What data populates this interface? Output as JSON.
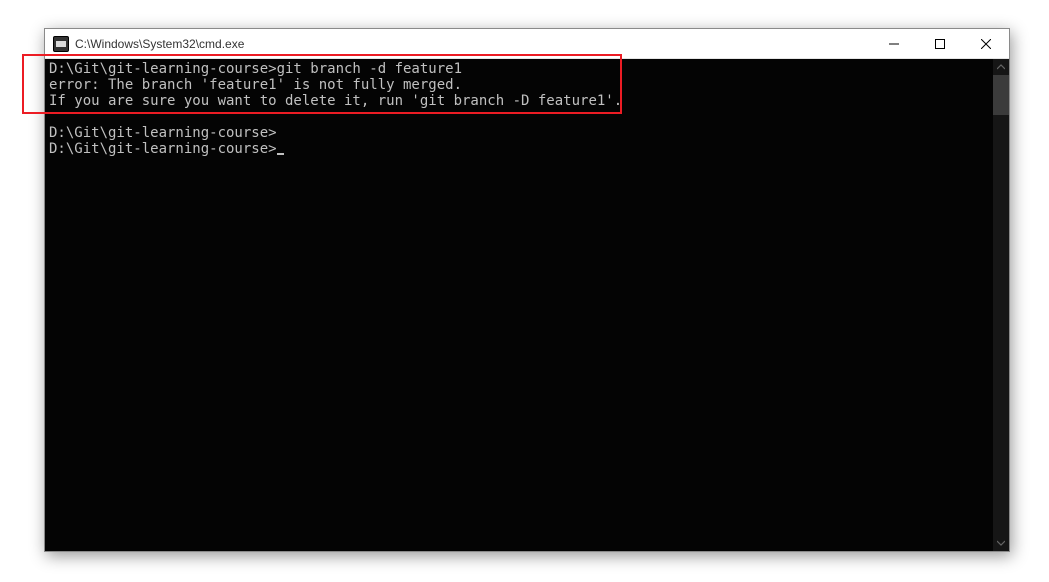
{
  "window": {
    "title": "C:\\Windows\\System32\\cmd.exe"
  },
  "terminal": {
    "lines": [
      "D:\\Git\\git-learning-course>git branch -d feature1",
      "error: The branch 'feature1' is not fully merged.",
      "If you are sure you want to delete it, run 'git branch -D feature1'.",
      "",
      "D:\\Git\\git-learning-course>",
      "D:\\Git\\git-learning-course>"
    ]
  }
}
